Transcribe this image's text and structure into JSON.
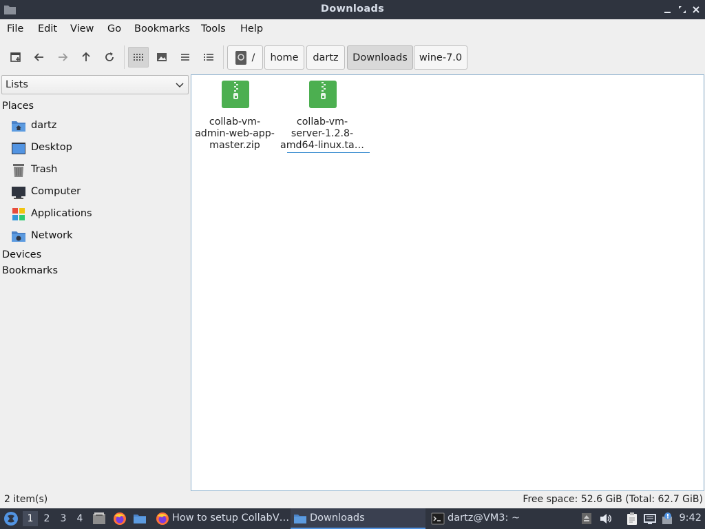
{
  "window": {
    "title": "Downloads"
  },
  "menu": [
    "File",
    "Edit",
    "View",
    "Go",
    "Bookmarks",
    "Tools",
    "Help"
  ],
  "breadcrumb": {
    "root": "/",
    "items": [
      "home",
      "dartz",
      "Downloads",
      "wine-7.0"
    ],
    "active": "Downloads"
  },
  "sidebar": {
    "mode": "Lists",
    "places_header": "Places",
    "places": [
      {
        "label": "dartz",
        "icon": "home-folder-icon"
      },
      {
        "label": "Desktop",
        "icon": "desktop-icon"
      },
      {
        "label": "Trash",
        "icon": "trash-icon"
      },
      {
        "label": "Computer",
        "icon": "computer-icon"
      },
      {
        "label": "Applications",
        "icon": "applications-icon"
      },
      {
        "label": "Network",
        "icon": "network-folder-icon"
      }
    ],
    "devices_header": "Devices",
    "bookmarks_header": "Bookmarks"
  },
  "files": [
    {
      "name_lines": [
        "collab-vm-",
        "admin-web-app-",
        "master.zip"
      ],
      "icon": "zip-archive-icon"
    },
    {
      "name_lines": [
        "collab-vm-",
        "server-1.2.8-",
        "amd64-linux.ta…"
      ],
      "icon": "zip-archive-icon",
      "focused": true
    }
  ],
  "status": {
    "items": "2 item(s)",
    "free_space": "Free space: 52.6 GiB (Total: 62.7 GiB)"
  },
  "taskbar": {
    "workspaces": [
      "1",
      "2",
      "3",
      "4"
    ],
    "active_workspace": "1",
    "tasks": [
      {
        "label": "How to setup CollabV…",
        "icon": "firefox-icon"
      },
      {
        "label": "Downloads",
        "icon": "folder-icon",
        "active": true
      },
      {
        "label": "dartz@VM3: ~",
        "icon": "terminal-icon"
      }
    ],
    "clock": "9:42"
  },
  "colors": {
    "titlebar": "#2f343f",
    "accent": "#5294e2",
    "zip_green": "#4caf50",
    "folder_blue": "#5294e2"
  }
}
